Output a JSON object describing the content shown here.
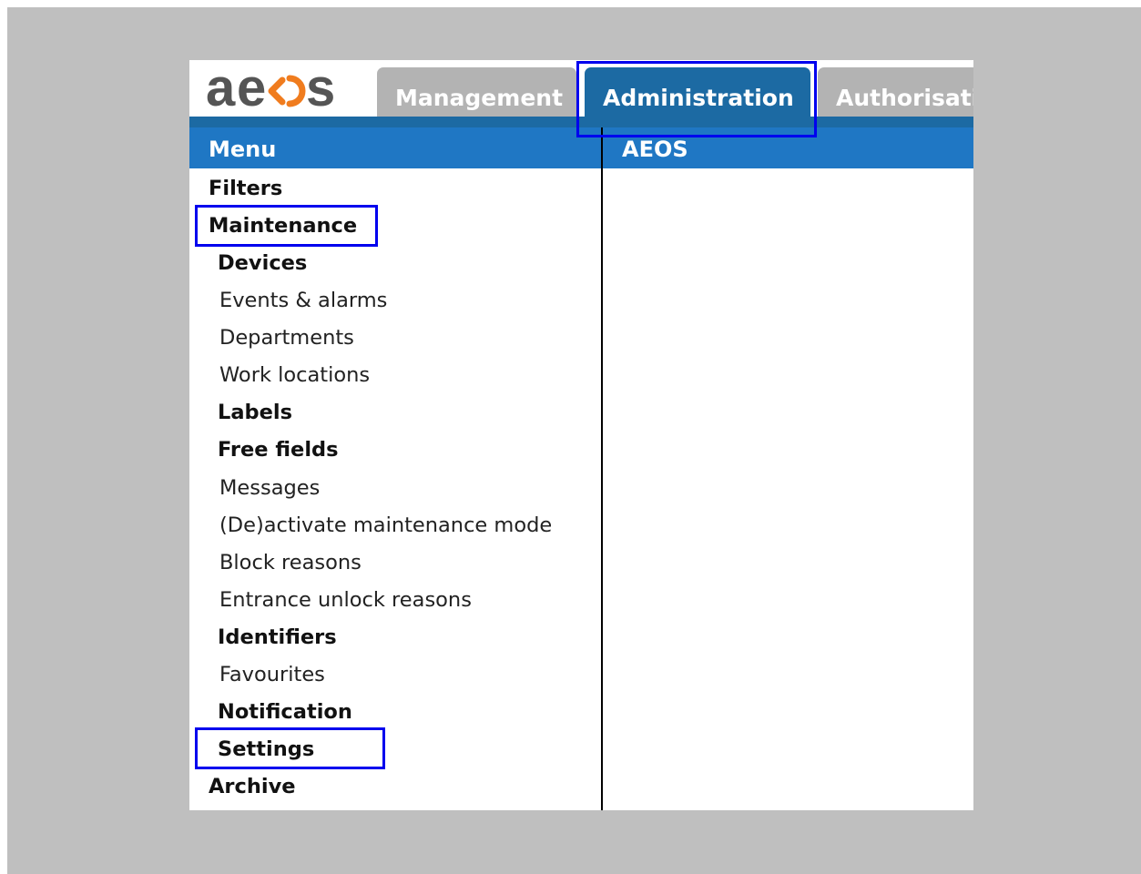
{
  "app": {
    "logo_text": "aeos"
  },
  "tabs": [
    {
      "label": "Management",
      "active": false
    },
    {
      "label": "Administration",
      "active": true
    },
    {
      "label": "Authorisati",
      "active": false
    }
  ],
  "menu": {
    "title": "Menu",
    "items": [
      {
        "label": "Filters",
        "level": 0
      },
      {
        "label": "Maintenance",
        "level": 0,
        "highlighted": true
      },
      {
        "label": "Devices",
        "level": 1
      },
      {
        "label": "Events & alarms",
        "level": 2
      },
      {
        "label": "Departments",
        "level": 2
      },
      {
        "label": "Work locations",
        "level": 2
      },
      {
        "label": "Labels",
        "level": 1
      },
      {
        "label": "Free fields",
        "level": 1
      },
      {
        "label": "Messages",
        "level": 2
      },
      {
        "label": "(De)activate maintenance mode",
        "level": 2
      },
      {
        "label": "Block reasons",
        "level": 2
      },
      {
        "label": "Entrance unlock reasons",
        "level": 2
      },
      {
        "label": "Identifiers",
        "level": 1
      },
      {
        "label": "Favourites",
        "level": 2
      },
      {
        "label": "Notification",
        "level": 1
      },
      {
        "label": "Settings",
        "level": 1,
        "highlighted": true
      },
      {
        "label": "Archive",
        "level": 0
      }
    ]
  },
  "content": {
    "title": "AEOS"
  },
  "colors": {
    "backdrop": "#bfbfbf",
    "tab_active": "#1c6aa3",
    "tab_inactive": "#b3b3b3",
    "header_bar": "#1f77c4",
    "logo_gray": "#555555",
    "logo_orange": "#f07c1e",
    "highlight_border": "#0000ee"
  }
}
